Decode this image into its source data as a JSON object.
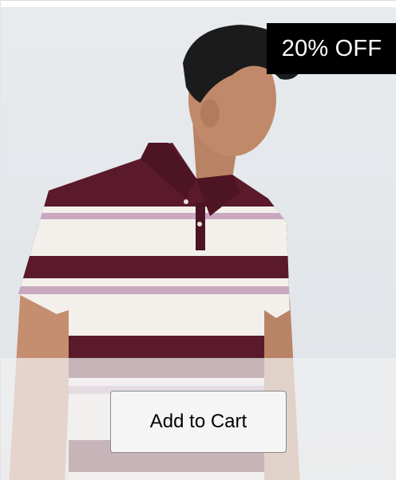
{
  "product": {
    "image_subject": "man-in-striped-polo",
    "shirt_colors": {
      "maroon": "#5a1a2b",
      "cream": "#f3f0ec",
      "lilac": "#c9a9c0"
    }
  },
  "badge": {
    "text": "20% OFF"
  },
  "actions": {
    "add_to_cart": "Add to Cart"
  }
}
